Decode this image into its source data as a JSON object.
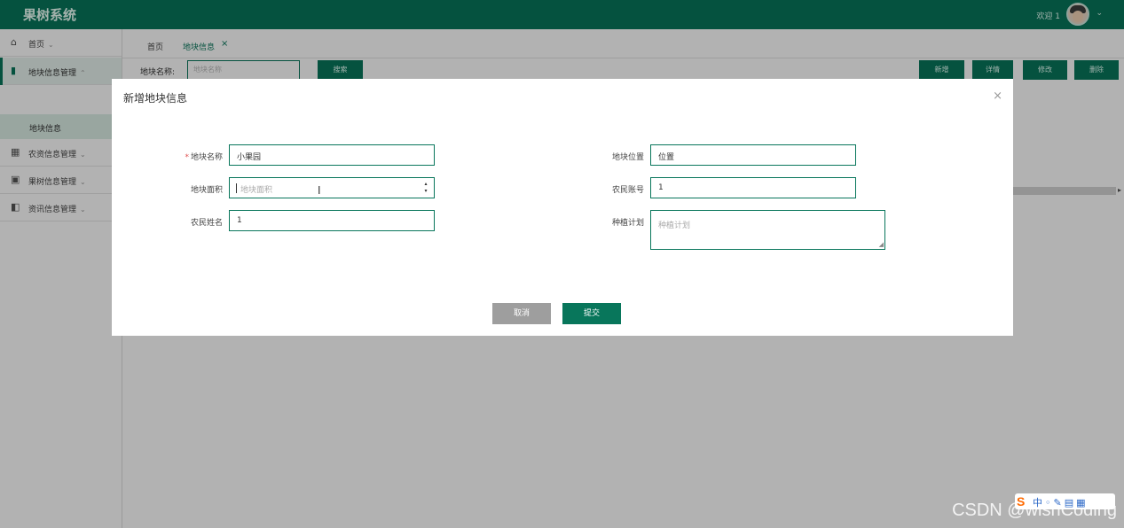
{
  "app": {
    "title": "果树系统",
    "welcome": "欢迎 1"
  },
  "sidebar": {
    "items": [
      {
        "label": "首页",
        "icon": "home-icon"
      },
      {
        "label": "地块信息管理",
        "icon": "field-icon"
      },
      {
        "label": "农资信息管理",
        "icon": "grid-icon"
      },
      {
        "label": "果树信息管理",
        "icon": "image-icon"
      },
      {
        "label": "资讯信息管理",
        "icon": "panel-icon"
      }
    ],
    "sub_item": "地块信息"
  },
  "tabs": [
    {
      "label": "首页"
    },
    {
      "label": "地块信息"
    }
  ],
  "toolbar": {
    "search_label": "地块名称:",
    "search_placeholder": "地块名称",
    "search_button": "搜索",
    "add_button": "新增",
    "detail_button": "详情",
    "edit_button": "修改",
    "delete_button": "删除"
  },
  "modal": {
    "title": "新增地块信息",
    "fields": {
      "name": {
        "label": "地块名称",
        "value": "小果园",
        "required": true
      },
      "location": {
        "label": "地块位置",
        "value": "位置"
      },
      "area": {
        "label": "地块面积",
        "placeholder": "地块面积"
      },
      "farmer_account": {
        "label": "农民账号",
        "value": "1"
      },
      "farmer_name": {
        "label": "农民姓名",
        "value": "1"
      },
      "plan": {
        "label": "种植计划",
        "placeholder": "种植计划"
      }
    },
    "cancel_button": "取消",
    "submit_button": "提交"
  },
  "watermark": "CSDN @wishCoding",
  "colors": {
    "brand": "#08765b",
    "cancel": "#9e9e9e"
  }
}
